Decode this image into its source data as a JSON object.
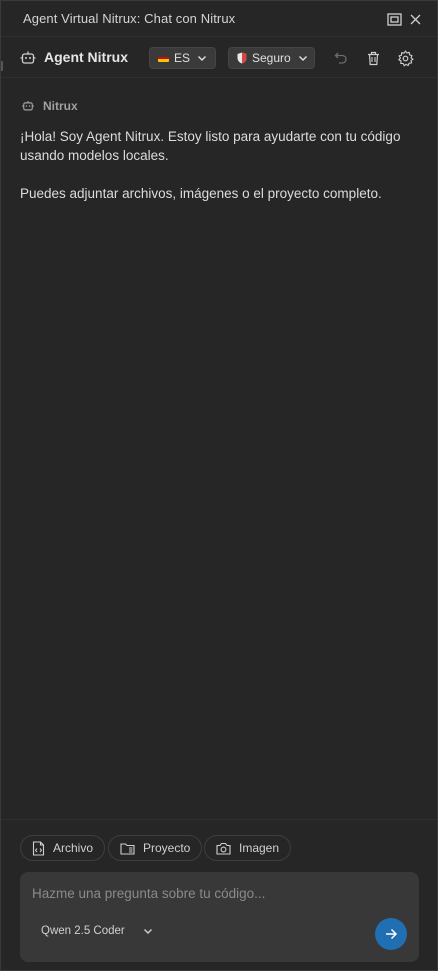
{
  "window": {
    "title": "Agent Virtual Nitrux: Chat con Nitrux"
  },
  "header": {
    "agent_name": "Agent Nitrux",
    "language": {
      "selected": "ES"
    },
    "mode": {
      "selected": "Seguro"
    }
  },
  "chat": {
    "messages": [
      {
        "author": "Nitrux",
        "paragraphs": [
          "¡Hola! Soy Agent Nitrux. Estoy listo para ayudarte con tu código usando modelos locales.",
          "Puedes adjuntar archivos, imágenes o el proyecto completo."
        ]
      }
    ]
  },
  "attachments": {
    "file_label": "Archivo",
    "project_label": "Proyecto",
    "image_label": "Imagen"
  },
  "composer": {
    "placeholder": "Hazme una pregunta sobre tu código...",
    "model": "Qwen 2.5 Coder"
  },
  "colors": {
    "send_button": "#1f6fb2",
    "background": "#262626",
    "composer": "#383838"
  }
}
